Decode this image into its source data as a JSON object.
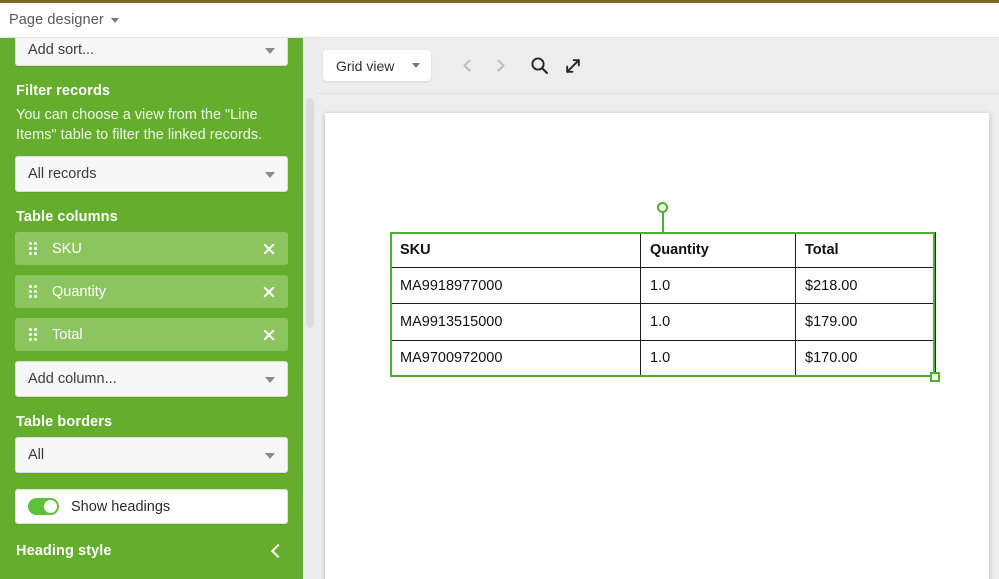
{
  "theme": {
    "accent_top_line": "#7a6a2c",
    "sidebar_green": "#64ad2d",
    "chip_green": "#8cc45f",
    "selection_green": "#4caf2e",
    "toggle_on_green": "#5cc03a"
  },
  "header": {
    "title": "Page designer",
    "caret_icon": "chevron-down-icon"
  },
  "sidebar": {
    "sort_select": {
      "label": "Add sort...",
      "caret_icon": "chevron-down-icon"
    },
    "filter_records": {
      "heading": "Filter records",
      "description": "You can choose a view from the \"Line Items\" table to filter the linked records.",
      "select_value": "All records",
      "caret_icon": "chevron-down-icon"
    },
    "table_columns": {
      "heading": "Table columns",
      "chips": [
        {
          "label": "SKU",
          "grip_icon": "drag-handle-icon",
          "remove_icon": "close-icon"
        },
        {
          "label": "Quantity",
          "grip_icon": "drag-handle-icon",
          "remove_icon": "close-icon"
        },
        {
          "label": "Total",
          "grip_icon": "drag-handle-icon",
          "remove_icon": "close-icon"
        }
      ],
      "add_column": {
        "label": "Add column...",
        "caret_icon": "chevron-down-icon"
      }
    },
    "table_borders": {
      "heading": "Table borders",
      "select_value": "All",
      "caret_icon": "chevron-down-icon"
    },
    "show_headings": {
      "label": "Show headings",
      "state": "on"
    },
    "heading_style": {
      "heading": "Heading style",
      "collapse_icon": "chevron-left-icon"
    }
  },
  "toolbar": {
    "view_select": {
      "label": "Grid view",
      "caret_icon": "chevron-down-icon"
    },
    "prev_icon": "chevron-left-icon",
    "next_icon": "chevron-right-icon",
    "search_icon": "search-icon",
    "expand_icon": "expand-arrows-icon"
  },
  "table_widget": {
    "selected": true,
    "rotate_handle_icon": "rotate-handle-icon",
    "resize_handle_icon": "resize-handle-icon",
    "columns": [
      "SKU",
      "Quantity",
      "Total"
    ],
    "rows": [
      [
        "MA9918977000",
        "1.0",
        "$218.00"
      ],
      [
        "MA9913515000",
        "1.0",
        "$179.00"
      ],
      [
        "MA9700972000",
        "1.0",
        "$170.00"
      ]
    ]
  }
}
